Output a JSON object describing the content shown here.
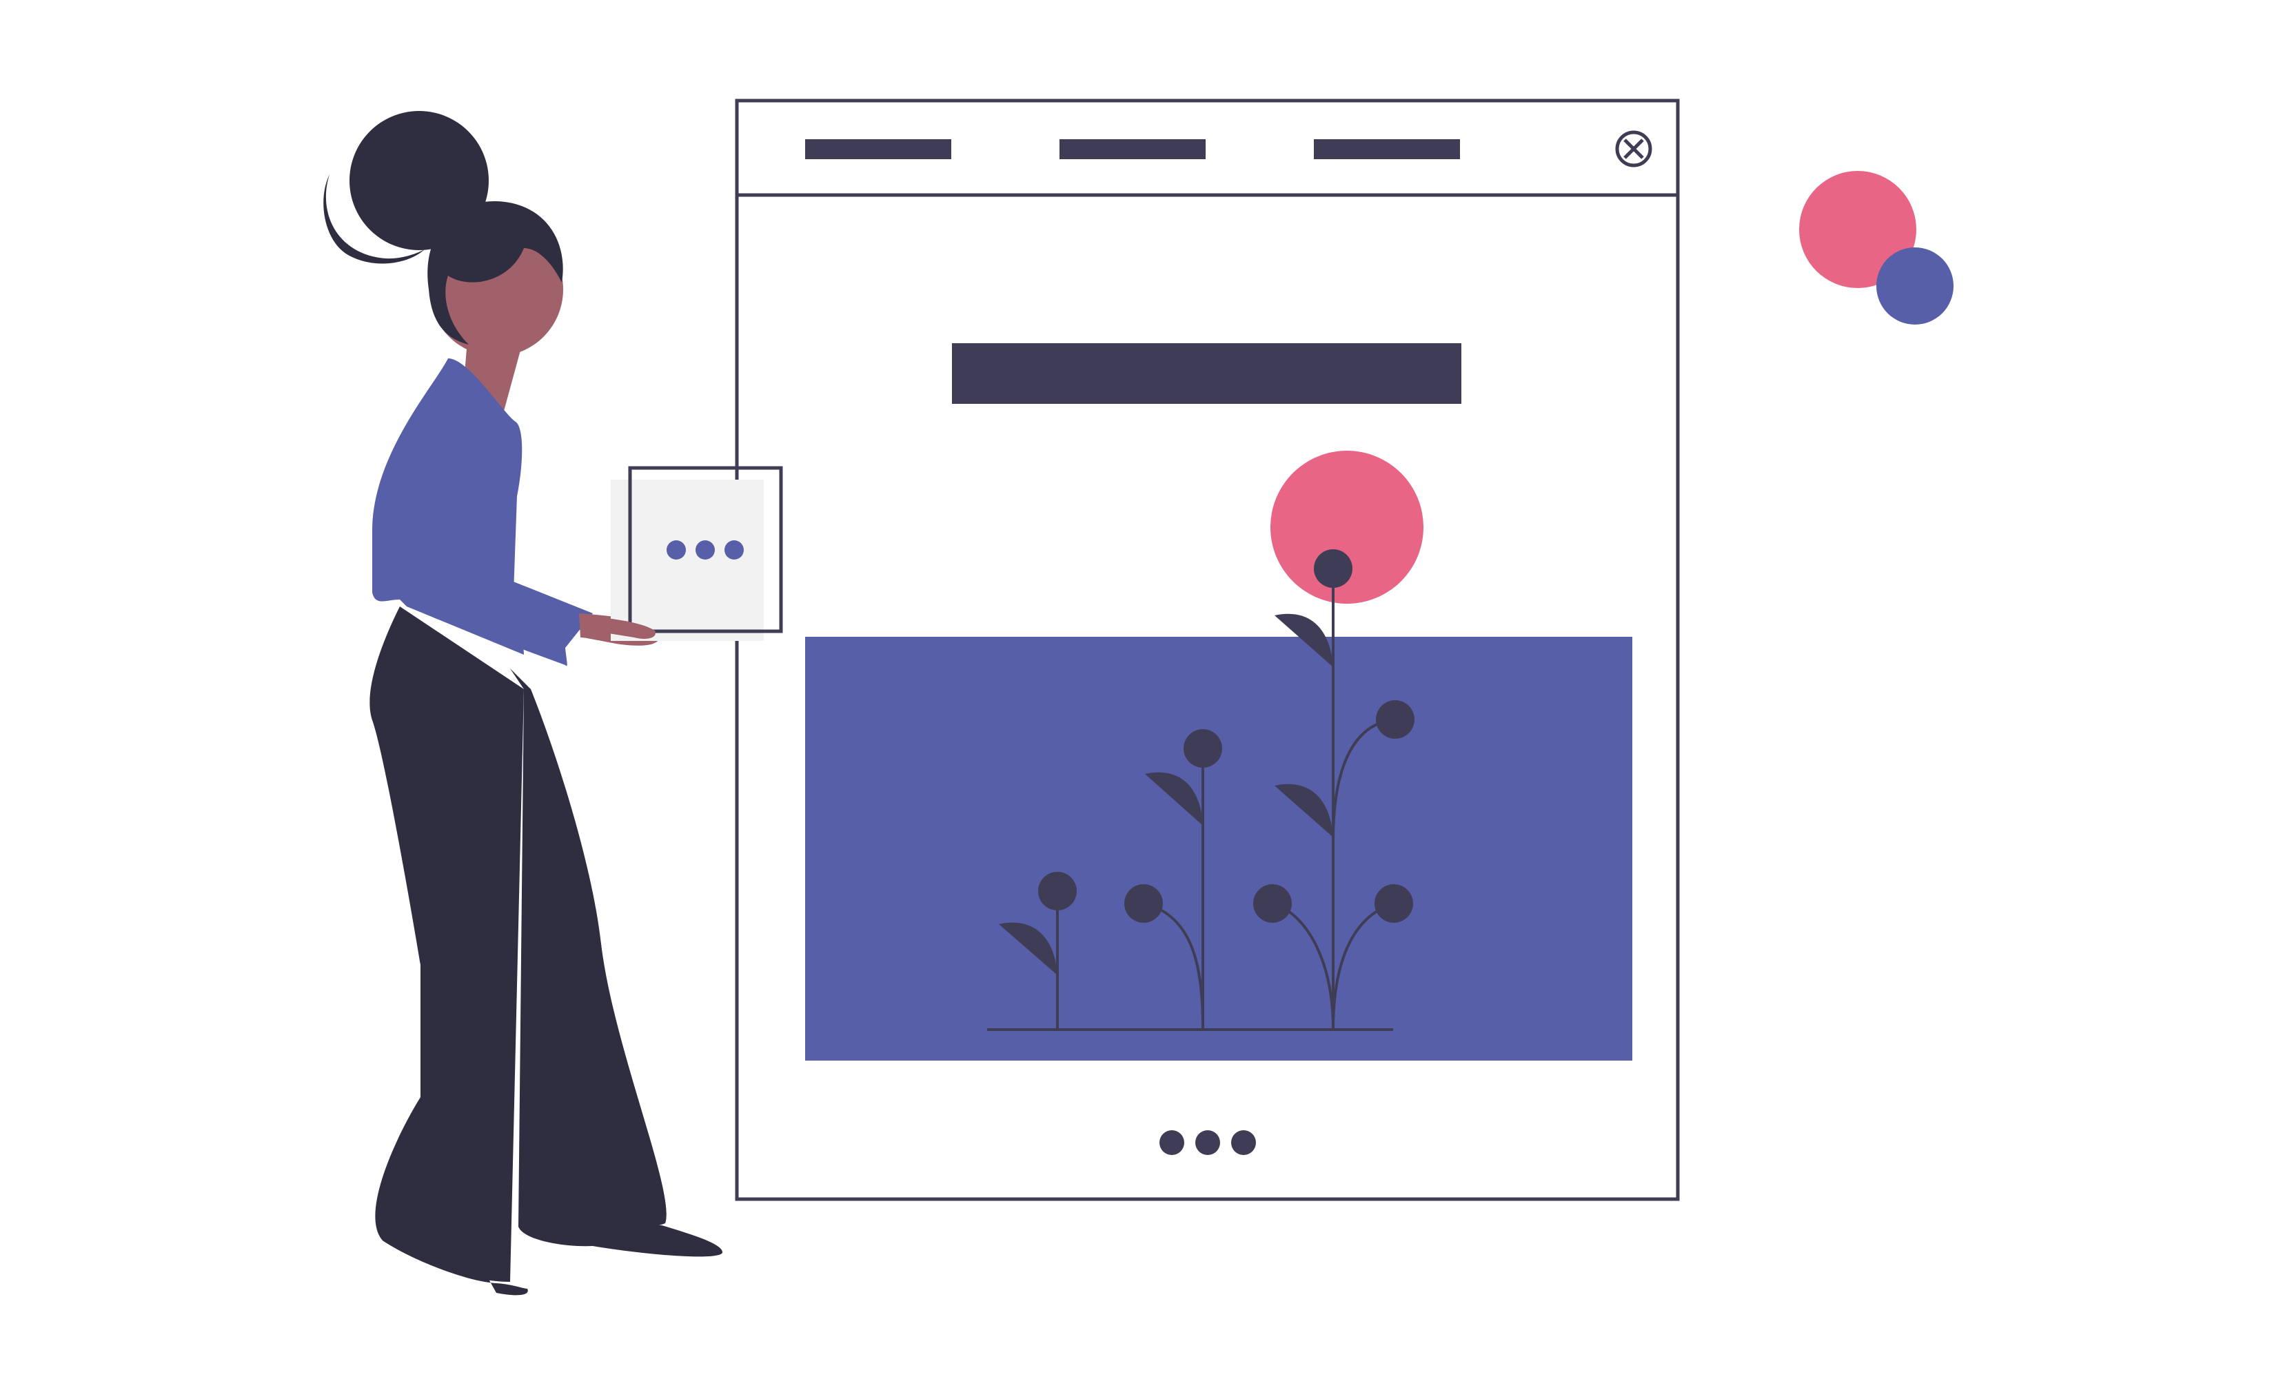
{
  "illustration": {
    "subject": "woman-holding-tablet-beside-website-window",
    "colors": {
      "background": "#ffffff",
      "outline": "#3f3d56",
      "nav_bar": "#3f3d56",
      "hero_bar": "#3f3d56",
      "content_panel": "#575fa8",
      "accent_pink": "#e96585",
      "accent_blue": "#575fa8",
      "plant_dark": "#3f3d56",
      "hair": "#2f2e41",
      "skin": "#a0616a",
      "shirt": "#575fa8",
      "pants": "#2f2e41",
      "tablet_screen": "#f2f2f2"
    },
    "browser_window": {
      "nav_items": [
        "nav-placeholder-1",
        "nav-placeholder-2",
        "nav-placeholder-3"
      ],
      "close_icon": "close-circle-x-icon",
      "pagination_dots": 3
    },
    "tablet": {
      "dots": 3
    },
    "decor_circles": [
      "pink",
      "blue"
    ]
  }
}
